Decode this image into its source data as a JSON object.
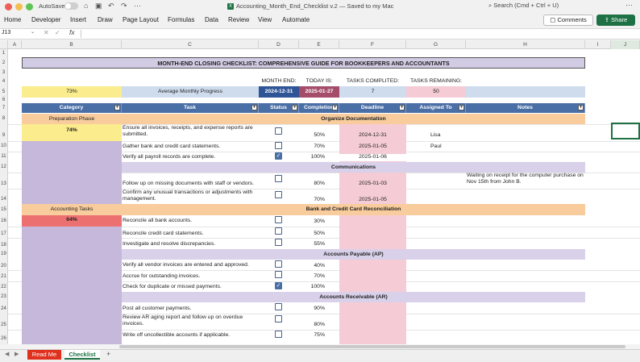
{
  "window": {
    "autosave_label": "AutoSave",
    "autosave_state": "off",
    "title": "Accounting_Month_End_Checklist v.2 — Saved to my Mac",
    "search_placeholder": "Search (Cmd + Ctrl + U)"
  },
  "ribbon": {
    "tabs": [
      "Home",
      "Developer",
      "Insert",
      "Draw",
      "Page Layout",
      "Formulas",
      "Data",
      "Review",
      "View",
      "Automate"
    ],
    "comments_label": "Comments",
    "share_label": "Share"
  },
  "formula_bar": {
    "name_box": "J13",
    "fx": "fx",
    "content": ""
  },
  "columns": [
    "A",
    "B",
    "C",
    "D",
    "E",
    "F",
    "G",
    "H",
    "I",
    "J"
  ],
  "rows": [
    "1",
    "2",
    "3",
    "4",
    "5",
    "6",
    "7",
    "8",
    "9",
    "10",
    "11",
    "12",
    "13",
    "14",
    "15",
    "16",
    "17",
    "18",
    "19",
    "20",
    "21",
    "22",
    "23",
    "24",
    "25",
    "26"
  ],
  "sheet": {
    "title": "MONTH-END CLOSING CHECKLIST: COMPREHENSIVE GUIDE FOR BOOKKEEPERS AND ACCOUNTANTS",
    "labels": {
      "month_end": "MONTH END:",
      "today_is": "TODAY IS:",
      "tasks_completed": "TASKS COMPLITED:",
      "tasks_remaining": "TASKS REMAINING:"
    },
    "summary": {
      "progress_pct": "73%",
      "avg_label": "Average Monthly Progress",
      "month_end": "2024-12-31",
      "today": "2025-01-27",
      "completed": "7",
      "remaining": "50"
    },
    "headers": {
      "category": "Category",
      "task": "Task",
      "status": "Status",
      "completion": "Completion",
      "deadline": "Deadline",
      "assigned": "Assigned To",
      "notes": "Notes"
    },
    "phases": {
      "prep": {
        "name": "Preparation Phase",
        "pct": "74%"
      },
      "acct": {
        "name": "Accounting Tasks",
        "pct": "64%"
      }
    },
    "sections": {
      "s8": "Organize Documentation",
      "s12": "Communications",
      "s15": "Bank and Credit Card Reconciliation",
      "s19": "Accounts Payable (AP)",
      "s23": "Accounts Receivable (AR)"
    },
    "tasks": {
      "r9": {
        "task": "Ensure all invoices, receipts, and expense reports are submitted.",
        "done": false,
        "completion": "50%",
        "deadline": "2024-12-31",
        "assigned": "Lisa",
        "notes": ""
      },
      "r10": {
        "task": "Gather bank and credit card statements.",
        "done": false,
        "completion": "70%",
        "deadline": "2025-01-05",
        "assigned": "Paul",
        "notes": ""
      },
      "r11": {
        "task": "Verify all payroll records are complete.",
        "done": true,
        "completion": "100%",
        "deadline": "2025-01-06",
        "assigned": "",
        "notes": ""
      },
      "r13": {
        "task": "Follow up on missing documents with staff or vendors.",
        "done": false,
        "completion": "80%",
        "deadline": "2025-01-03",
        "assigned": "",
        "notes": "Waiting on receipt for the computer purchase on Nov 15th from John B."
      },
      "r14": {
        "task": "Confirm any unusual transactions or adjustments with management.",
        "done": false,
        "completion": "70%",
        "deadline": "2025-01-05",
        "assigned": "",
        "notes": ""
      },
      "r16": {
        "task": "Reconcile all bank accounts.",
        "done": false,
        "completion": "30%",
        "deadline": "",
        "assigned": "",
        "notes": ""
      },
      "r17": {
        "task": "Reconcile credit card statements.",
        "done": false,
        "completion": "50%",
        "deadline": "",
        "assigned": "",
        "notes": ""
      },
      "r18": {
        "task": "Investigate and resolve discrepancies.",
        "done": false,
        "completion": "55%",
        "deadline": "",
        "assigned": "",
        "notes": ""
      },
      "r20": {
        "task": "Verify all vendor invoices are entered and approved.",
        "done": false,
        "completion": "40%",
        "deadline": "",
        "assigned": "",
        "notes": ""
      },
      "r21": {
        "task": "Accrue for outstanding invoices.",
        "done": false,
        "completion": "70%",
        "deadline": "",
        "assigned": "",
        "notes": ""
      },
      "r22": {
        "task": "Check for duplicate or missed payments.",
        "done": true,
        "completion": "100%",
        "deadline": "",
        "assigned": "",
        "notes": ""
      },
      "r24": {
        "task": "Post all customer payments.",
        "done": false,
        "completion": "90%",
        "deadline": "",
        "assigned": "",
        "notes": ""
      },
      "r25": {
        "task": "Review AR aging report and follow up on overdue invoices.",
        "done": false,
        "completion": "80%",
        "deadline": "",
        "assigned": "",
        "notes": ""
      },
      "r26": {
        "task": "Write off uncollectible accounts if applicable.",
        "done": false,
        "completion": "75%",
        "deadline": "",
        "assigned": "",
        "notes": ""
      }
    }
  },
  "sheet_tabs": {
    "readme": "Read Me",
    "checklist": "Checklist",
    "add": "+"
  }
}
